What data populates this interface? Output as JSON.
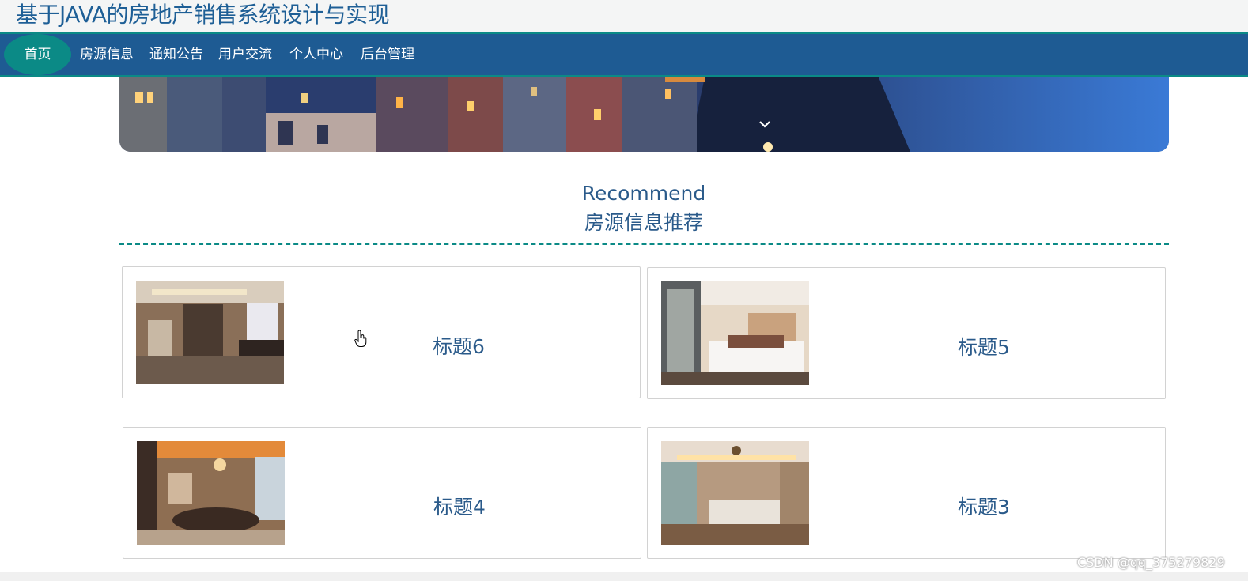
{
  "site_title": "基于JAVA的房地产销售系统设计与实现",
  "nav": {
    "home": "首页",
    "items": [
      "房源信息",
      "通知公告",
      "用户交流",
      "个人中心",
      "后台管理"
    ]
  },
  "section": {
    "title_en": "Recommend",
    "title_cn": "房源信息推荐"
  },
  "cards": [
    {
      "title": "标题6"
    },
    {
      "title": "标题5"
    },
    {
      "title": "标题4"
    },
    {
      "title": "标题3"
    }
  ],
  "watermark": "CSDN @qq_375279829",
  "colors": {
    "nav_bg": "#1e5b93",
    "accent": "#0b8a86",
    "text": "#2a5a8a"
  },
  "icons": [
    "chevron-down-icon",
    "hand-cursor-icon"
  ]
}
